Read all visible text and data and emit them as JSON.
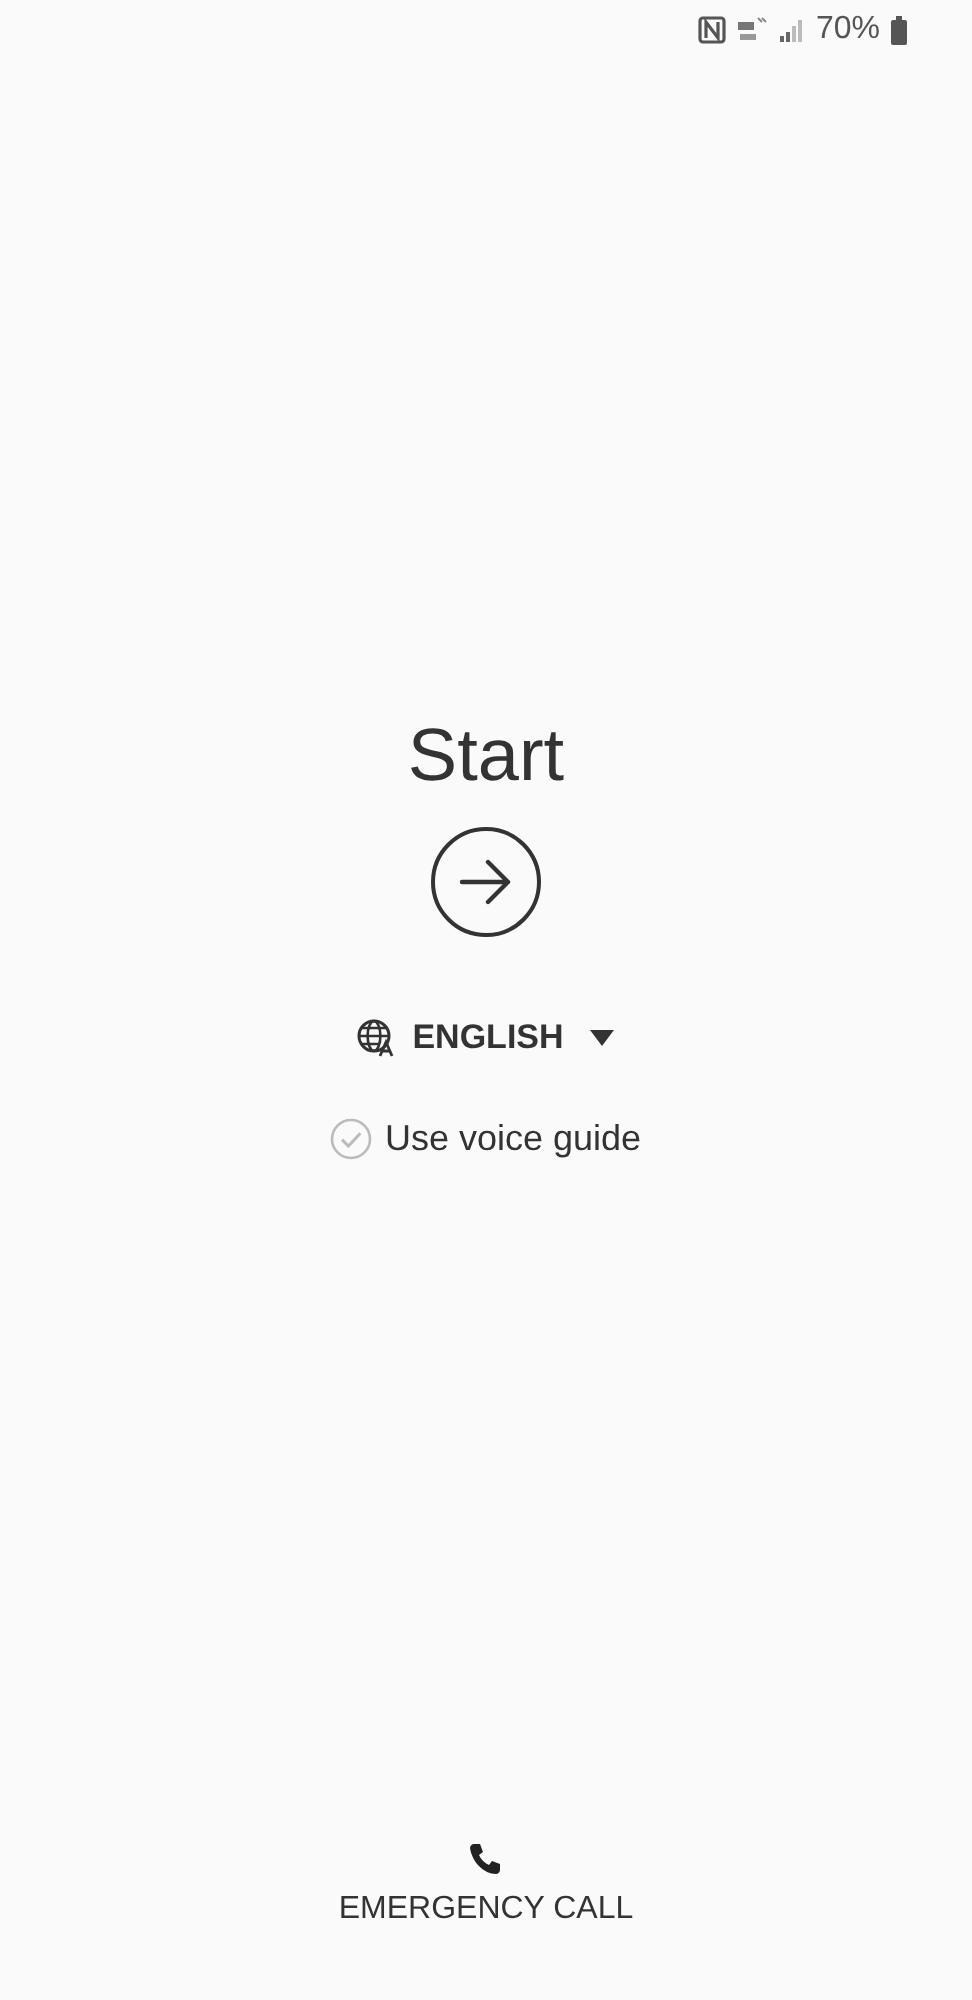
{
  "status_bar": {
    "battery_text": "70%"
  },
  "start": {
    "title": "Start"
  },
  "language": {
    "label": "ENGLISH"
  },
  "voice_guide": {
    "label": "Use voice guide",
    "checked": false
  },
  "emergency": {
    "label": "EMERGENCY CALL"
  }
}
